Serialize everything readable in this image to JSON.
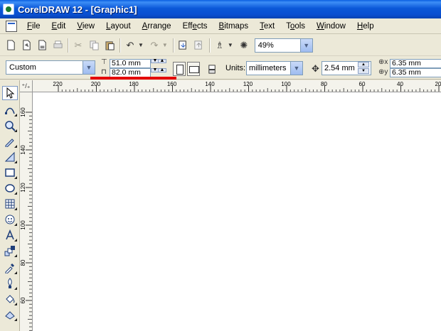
{
  "window": {
    "title": "CorelDRAW 12 - [Graphic1]"
  },
  "menu": [
    {
      "label": "File",
      "mnemonic": "F",
      "rest": "ile"
    },
    {
      "label": "Edit",
      "mnemonic": "E",
      "rest": "dit"
    },
    {
      "label": "View",
      "mnemonic": "V",
      "rest": "iew"
    },
    {
      "label": "Layout",
      "mnemonic": "L",
      "rest": "ayout"
    },
    {
      "label": "Arrange",
      "mnemonic": "A",
      "rest": "rrange"
    },
    {
      "label": "Effects",
      "pre": "Eff",
      "mnemonic": "e",
      "rest": "cts"
    },
    {
      "label": "Bitmaps",
      "mnemonic": "B",
      "rest": "itmaps"
    },
    {
      "label": "Text",
      "mnemonic": "T",
      "rest": "ext"
    },
    {
      "label": "Tools",
      "pre": "T",
      "mnemonic": "o",
      "rest": "ols"
    },
    {
      "label": "Window",
      "mnemonic": "W",
      "rest": "indow"
    },
    {
      "label": "Help",
      "mnemonic": "H",
      "rest": "elp"
    }
  ],
  "toolbar": {
    "zoom": "49%"
  },
  "property_bar": {
    "page_size": "Custom",
    "width": "51.0 mm",
    "height": "82.0 mm",
    "units_label": "Units:",
    "units": "millimeters",
    "nudge": "2.54 mm",
    "dup_x": "6.35 mm",
    "dup_y": "6.35 mm"
  },
  "ruler": {
    "h_ticks": [
      "220",
      "200",
      "180",
      "160",
      "140",
      "120",
      "100",
      "80",
      "60",
      "40",
      "20"
    ],
    "v_ticks": [
      "160",
      "140",
      "120",
      "100",
      "80",
      "60"
    ]
  }
}
